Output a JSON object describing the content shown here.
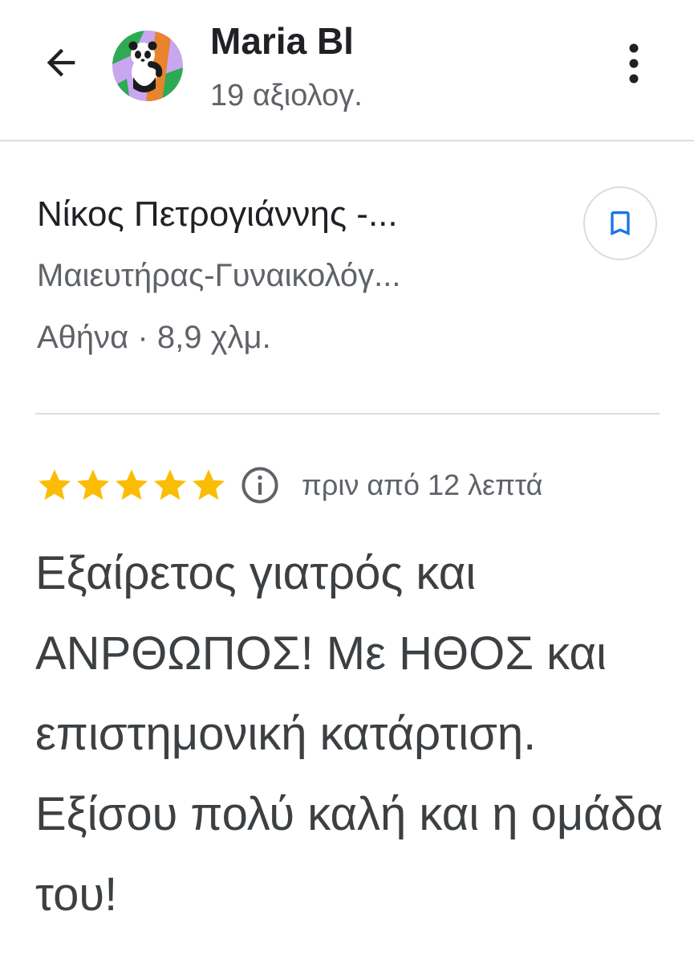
{
  "header": {
    "user_name": "Maria Bl",
    "user_reviews": "19 αξιολογ.",
    "back_icon": "arrow-left-icon",
    "more_icon": "more-vertical-icon"
  },
  "place": {
    "name": "Νίκος Πετρογιάννης -...",
    "category": "Μαιευτήρας-Γυναικολόγ...",
    "location": "Αθήνα · 8,9 χλμ.",
    "save_icon": "bookmark-icon"
  },
  "review": {
    "rating": 5,
    "rating_max": 5,
    "time": "πριν από 12 λεπτά",
    "text": "Εξαίρετος γιατρός και ΑΝΡΘΩΠΟΣ! Με ΗΘΟΣ και επιστημονική κατάρτιση. Εξίσου πολύ καλή και η ομάδα του!"
  },
  "colors": {
    "star": "#fbbc04",
    "accent": "#1a73e8",
    "secondary_text": "#5f6368",
    "divider": "#dadce0"
  }
}
